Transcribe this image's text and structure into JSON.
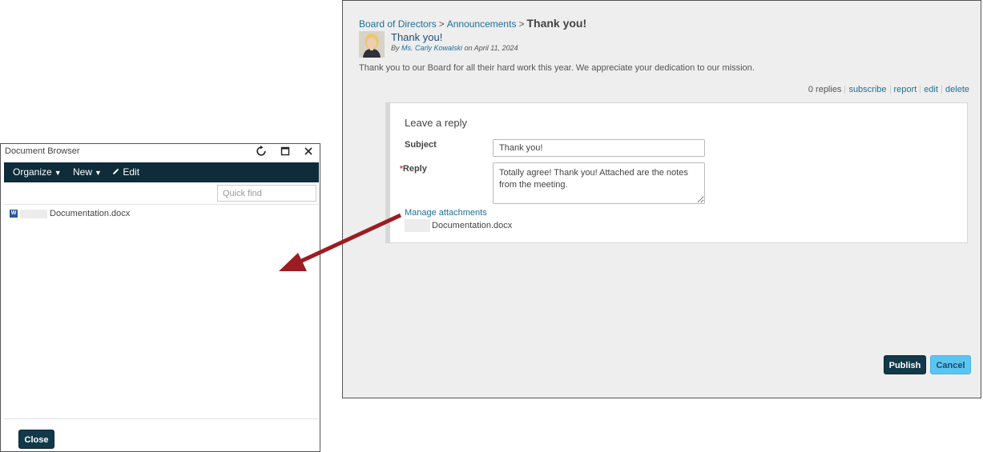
{
  "forum": {
    "breadcrumb": {
      "level1": "Board of Directors",
      "sep1": ">",
      "level2": "Announcements",
      "sep2": ">",
      "current": "Thank you!"
    },
    "post": {
      "title": "Thank you!",
      "by_prefix": "By",
      "author": "Ms. Carly Kowalski",
      "date_text": "on April 11, 2024",
      "body": "Thank you to our Board for all their hard work this year. We appreciate your dedication to our mission."
    },
    "actions": {
      "replies": "0 replies",
      "subscribe": "subscribe",
      "report": "report",
      "edit": "edit",
      "delete": "delete"
    },
    "reply_form": {
      "heading": "Leave a reply",
      "subject_label": "Subject",
      "subject_value": "Thank you!",
      "required_mark": "*",
      "reply_label": "Reply",
      "reply_value": "Totally agree! Thank you! Attached are the notes from the meeting.",
      "manage_attachments": "Manage attachments",
      "attachment_name": "Documentation.docx"
    },
    "buttons": {
      "publish": "Publish",
      "cancel": "Cancel"
    }
  },
  "doc_browser": {
    "title": "Document Browser",
    "toolbar": {
      "organize": "Organize",
      "new": "New",
      "edit": "Edit"
    },
    "quick_find_placeholder": "Quick find",
    "files": [
      {
        "name": "Documentation.docx",
        "icon": "word-doc-icon"
      }
    ],
    "close_label": "Close"
  },
  "colors": {
    "toolbar_bg": "#0e2c3a",
    "primary_button": "#12394a",
    "cancel_button": "#5bc5f2",
    "link": "#1f6f9a",
    "arrow": "#9b1c22"
  }
}
